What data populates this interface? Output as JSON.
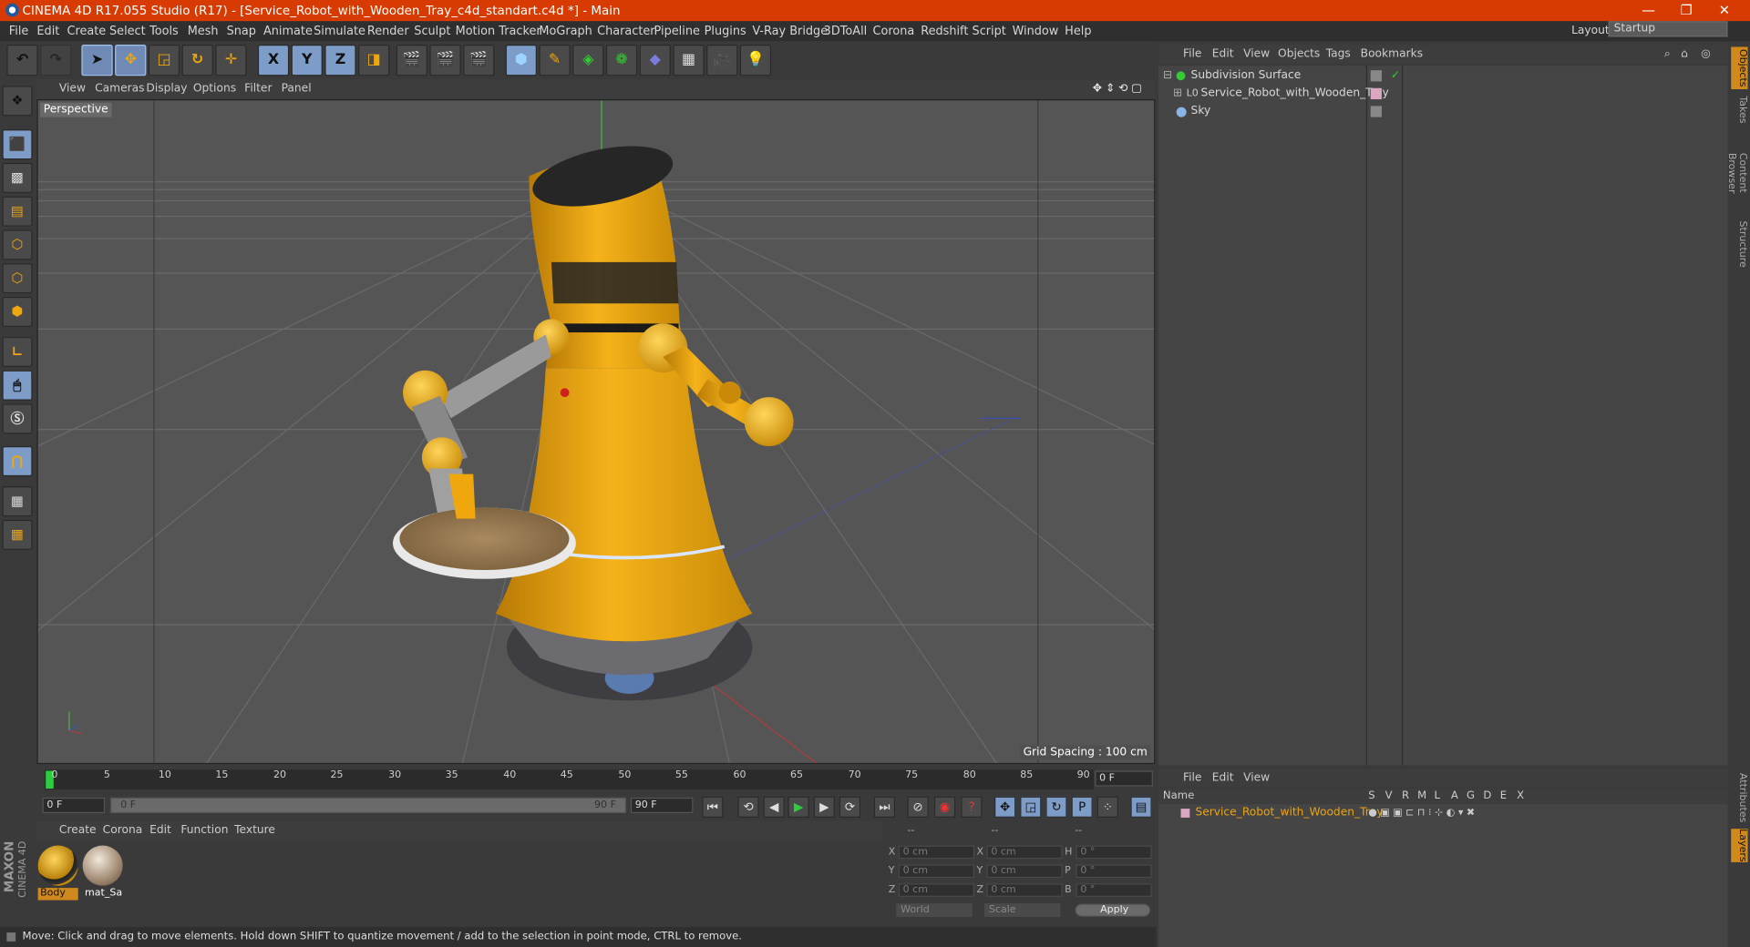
{
  "window": {
    "title": "CINEMA 4D R17.055 Studio (R17) - [Service_Robot_with_Wooden_Tray_c4d_standart.c4d *] - Main",
    "minimize": "—",
    "restore": "❐",
    "close": "✕"
  },
  "menubar": {
    "items": [
      "File",
      "Edit",
      "Create",
      "Select",
      "Tools",
      "Mesh",
      "Snap",
      "Animate",
      "Simulate",
      "Render",
      "Sculpt",
      "Motion Tracker",
      "MoGraph",
      "Character",
      "Pipeline",
      "Plugins",
      "V-Ray Bridge",
      "3DToAll",
      "Corona",
      "Redshift",
      "Script",
      "Window",
      "Help"
    ],
    "layout_label": "Layout:",
    "layout_value": "Startup"
  },
  "toolbar": {
    "axis_x": "X",
    "axis_y": "Y",
    "axis_z": "Z"
  },
  "viewport": {
    "menu": [
      "View",
      "Cameras",
      "Display",
      "Options",
      "Filter",
      "Panel"
    ],
    "label": "Perspective",
    "grid_spacing": "Grid Spacing : 100 cm"
  },
  "timeline": {
    "ticks": [
      "0",
      "5",
      "10",
      "15",
      "20",
      "25",
      "30",
      "35",
      "40",
      "45",
      "50",
      "55",
      "60",
      "65",
      "70",
      "75",
      "80",
      "85",
      "90"
    ],
    "current_frame": "0 F",
    "start_field": "0 F",
    "range_start": "0 F",
    "range_end": "90 F",
    "end_field": "90 F"
  },
  "materials": {
    "menu": [
      "Create",
      "Corona",
      "Edit",
      "Function",
      "Texture"
    ],
    "items": [
      {
        "name": "Body"
      },
      {
        "name": "mat_Sal"
      }
    ],
    "maxon": "MAXON",
    "cinema": "CINEMA 4D"
  },
  "coordinates": {
    "header": [
      "--",
      "--",
      "--"
    ],
    "rows": [
      {
        "a": "X",
        "av": "0 cm",
        "b": "X",
        "bv": "0 cm",
        "c": "H",
        "cv": "0 °"
      },
      {
        "a": "Y",
        "av": "0 cm",
        "b": "Y",
        "bv": "0 cm",
        "c": "P",
        "cv": "0 °"
      },
      {
        "a": "Z",
        "av": "0 cm",
        "b": "Z",
        "bv": "0 cm",
        "c": "B",
        "cv": "0 °"
      }
    ],
    "world": "World",
    "scale": "Scale",
    "apply": "Apply"
  },
  "status": {
    "text": "Move: Click and drag to move elements. Hold down SHIFT to quantize movement / add to the selection in point mode, CTRL to remove."
  },
  "object_manager": {
    "menu": [
      "File",
      "Edit",
      "View",
      "Objects",
      "Tags",
      "Bookmarks"
    ],
    "objects": [
      {
        "name": "Subdivision Surface"
      },
      {
        "name": "Service_Robot_with_Wooden_Tray"
      },
      {
        "name": "Sky"
      }
    ]
  },
  "layer_manager": {
    "menu": [
      "File",
      "Edit",
      "View"
    ],
    "columns": [
      "Name",
      "S",
      "V",
      "R",
      "M",
      "L",
      "A",
      "G",
      "D",
      "E",
      "X"
    ],
    "layers": [
      {
        "name": "Service_Robot_with_Wooden_Tray"
      }
    ]
  },
  "right_tabs": [
    "Objects",
    "Takes",
    "Content Browser",
    "Structure",
    "Attributes",
    "Layers"
  ],
  "colors": {
    "titlebar": "#d83b01",
    "accent_orange": "#d0891c",
    "robot_yellow": "#f0a70e",
    "selection_blue": "#7d9cc8"
  }
}
